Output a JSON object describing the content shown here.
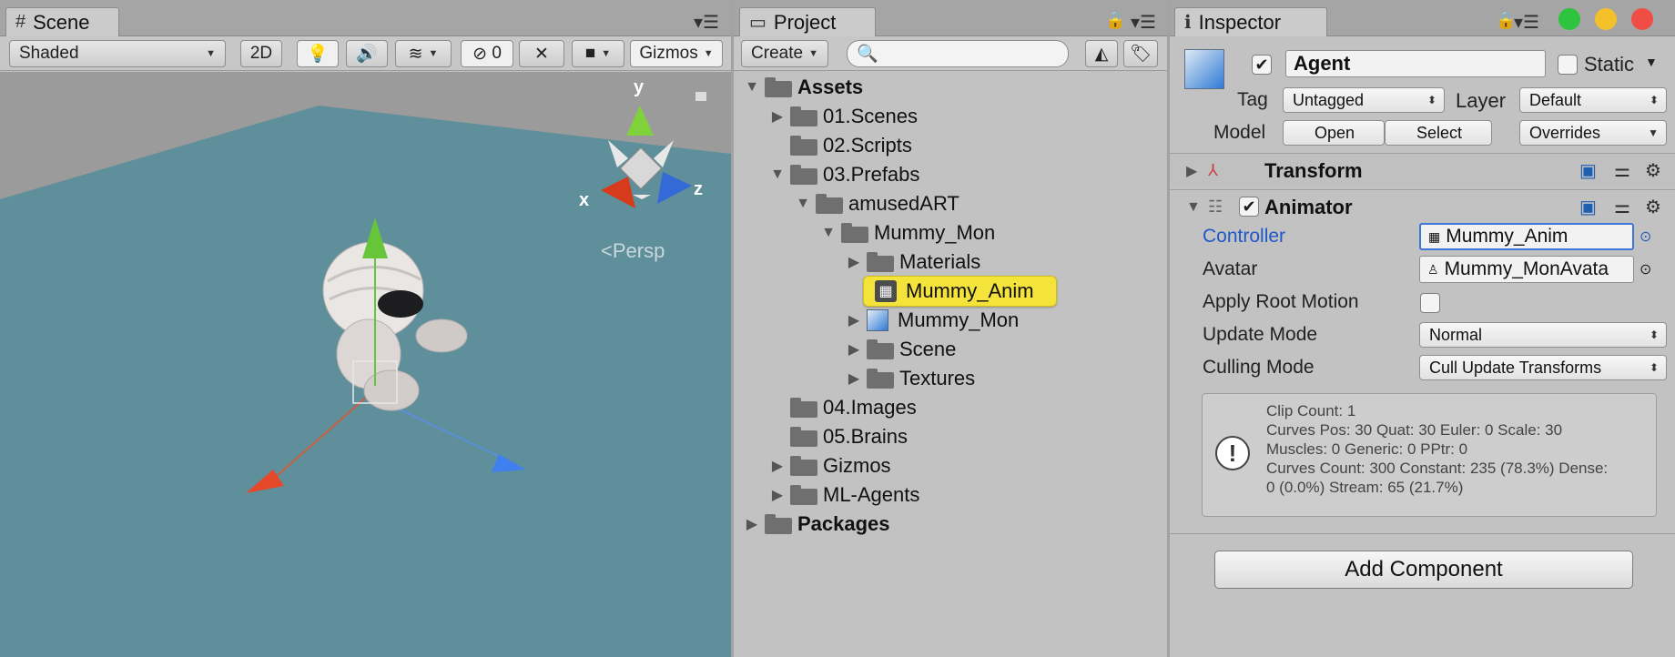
{
  "scene": {
    "tab_label": "Scene",
    "toolbar": {
      "shading_mode": "Shaded",
      "mode_2d": "2D",
      "hidden_count": "0",
      "gizmos_label": "Gizmos"
    },
    "persp_label": "Persp",
    "axis_labels": {
      "x": "x",
      "y": "y",
      "z": "z"
    }
  },
  "project": {
    "tab_label": "Project",
    "create_label": "Create",
    "search_placeholder": "",
    "tree": [
      {
        "label": "Assets",
        "bold": true,
        "expanded": true,
        "indent": 0
      },
      {
        "label": "01.Scenes",
        "indent": 1,
        "expandable": true
      },
      {
        "label": "02.Scripts",
        "indent": 1
      },
      {
        "label": "03.Prefabs",
        "indent": 1,
        "expanded": true
      },
      {
        "label": "amusedART",
        "indent": 2,
        "expanded": true
      },
      {
        "label": "Mummy_Mon",
        "indent": 3,
        "expanded": true
      },
      {
        "label": "Materials",
        "indent": 4,
        "expandable": true
      },
      {
        "label": "Mummy_Anim",
        "indent": 4,
        "selected": true
      },
      {
        "label": "Mummy_Mon",
        "indent": 4,
        "expandable": true
      },
      {
        "label": "Scene",
        "indent": 4,
        "expandable": true
      },
      {
        "label": "Textures",
        "indent": 4,
        "expandable": true
      },
      {
        "label": "04.Images",
        "indent": 1
      },
      {
        "label": "05.Brains",
        "indent": 1
      },
      {
        "label": "Gizmos",
        "indent": 1,
        "expandable": true
      },
      {
        "label": "ML-Agents",
        "indent": 1,
        "expandable": true
      },
      {
        "label": "Packages",
        "bold": true,
        "indent": 0,
        "expandable": true
      }
    ]
  },
  "inspector": {
    "tab_label": "Inspector",
    "object_name": "Agent",
    "static_label": "Static",
    "tag_label": "Tag",
    "tag_value": "Untagged",
    "layer_label": "Layer",
    "layer_value": "Default",
    "model_label": "Model",
    "open_label": "Open",
    "select_label": "Select",
    "overrides_label": "Overrides",
    "transform_label": "Transform",
    "animator_label": "Animator",
    "controller_label": "Controller",
    "controller_value": "Mummy_Anim",
    "avatar_label": "Avatar",
    "avatar_value": "Mummy_MonAvata",
    "apply_root_motion_label": "Apply Root Motion",
    "update_mode_label": "Update Mode",
    "update_mode_value": "Normal",
    "culling_mode_label": "Culling Mode",
    "culling_mode_value": "Cull Update Transforms",
    "info_lines": [
      "Clip Count: 1",
      "Curves Pos: 30 Quat: 30 Euler: 0 Scale: 30",
      "Muscles: 0 Generic: 0 PPtr: 0",
      "Curves Count: 300 Constant: 235 (78.3%) Dense:",
      "0 (0.0%) Stream: 65 (21.7%)"
    ],
    "add_component_label": "Add Component"
  },
  "colors": {
    "selection": "#f3e33a",
    "ground": "#5f8f9b",
    "sky": "#9a9a9a",
    "link_blue": "#1f58c9",
    "traffic_green": "#2fc43d",
    "traffic_yellow": "#f5c12b",
    "traffic_red": "#f04e45"
  }
}
